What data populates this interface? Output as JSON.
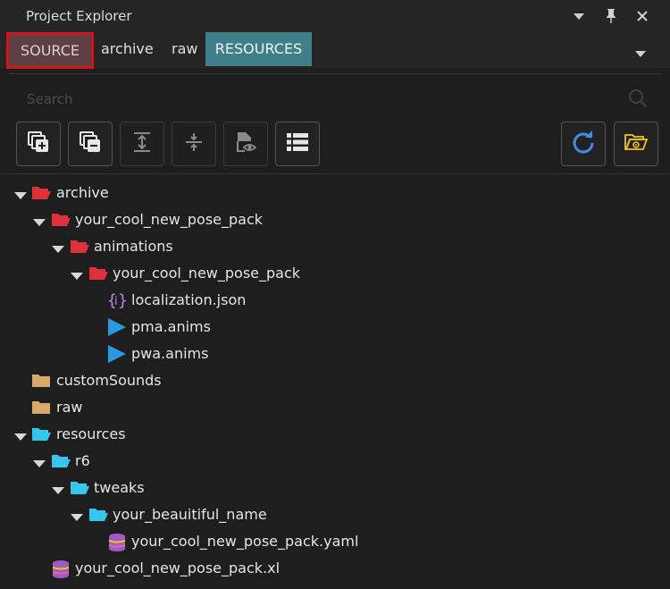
{
  "window": {
    "title": "Project Explorer"
  },
  "tabs": [
    {
      "label": "SOURCE"
    },
    {
      "label": "archive"
    },
    {
      "label": "raw"
    },
    {
      "label": "RESOURCES"
    }
  ],
  "search": {
    "placeholder": "Search",
    "value": ""
  },
  "toolbar": {
    "buttons": [
      "add-file-icon",
      "remove-file-icon",
      "expand-all-icon",
      "collapse-all-icon",
      "preview-file-icon",
      "list-view-icon",
      "refresh-icon",
      "open-folder-icon"
    ]
  },
  "colors": {
    "archive_folder": "#e0313b",
    "raw_folder": "#d9a86c",
    "resource_folder": "#35c7ee",
    "anim_icon": "#2b98e3",
    "json_icon": "#b888e8",
    "yaml_icon": "#a05ac6",
    "source_tab_border": "#d4131c",
    "resources_tab_bg": "#3f7f89",
    "refresh_icon": "#3f8ee6",
    "open_folder_icon": "#f0c419"
  },
  "tree": [
    {
      "label": "archive",
      "icon": "folder-open-red-icon"
    },
    {
      "label": "your_cool_new_pose_pack",
      "icon": "folder-open-red-icon"
    },
    {
      "label": "animations",
      "icon": "folder-open-red-icon"
    },
    {
      "label": "your_cool_new_pose_pack",
      "icon": "folder-open-red-icon"
    },
    {
      "label": "localization.json",
      "icon": "json-file-icon"
    },
    {
      "label": "pma.anims",
      "icon": "anims-file-icon"
    },
    {
      "label": "pwa.anims",
      "icon": "anims-file-icon"
    },
    {
      "label": "customSounds",
      "icon": "folder-tan-icon"
    },
    {
      "label": "raw",
      "icon": "folder-tan-icon"
    },
    {
      "label": "resources",
      "icon": "folder-open-cyan-icon"
    },
    {
      "label": "r6",
      "icon": "folder-open-cyan-icon"
    },
    {
      "label": "tweaks",
      "icon": "folder-open-cyan-icon"
    },
    {
      "label": "your_beauitiful_name",
      "icon": "folder-open-cyan-icon"
    },
    {
      "label": "your_cool_new_pose_pack.yaml",
      "icon": "yaml-file-icon"
    },
    {
      "label": "your_cool_new_pose_pack.xl",
      "icon": "xl-file-icon"
    }
  ]
}
